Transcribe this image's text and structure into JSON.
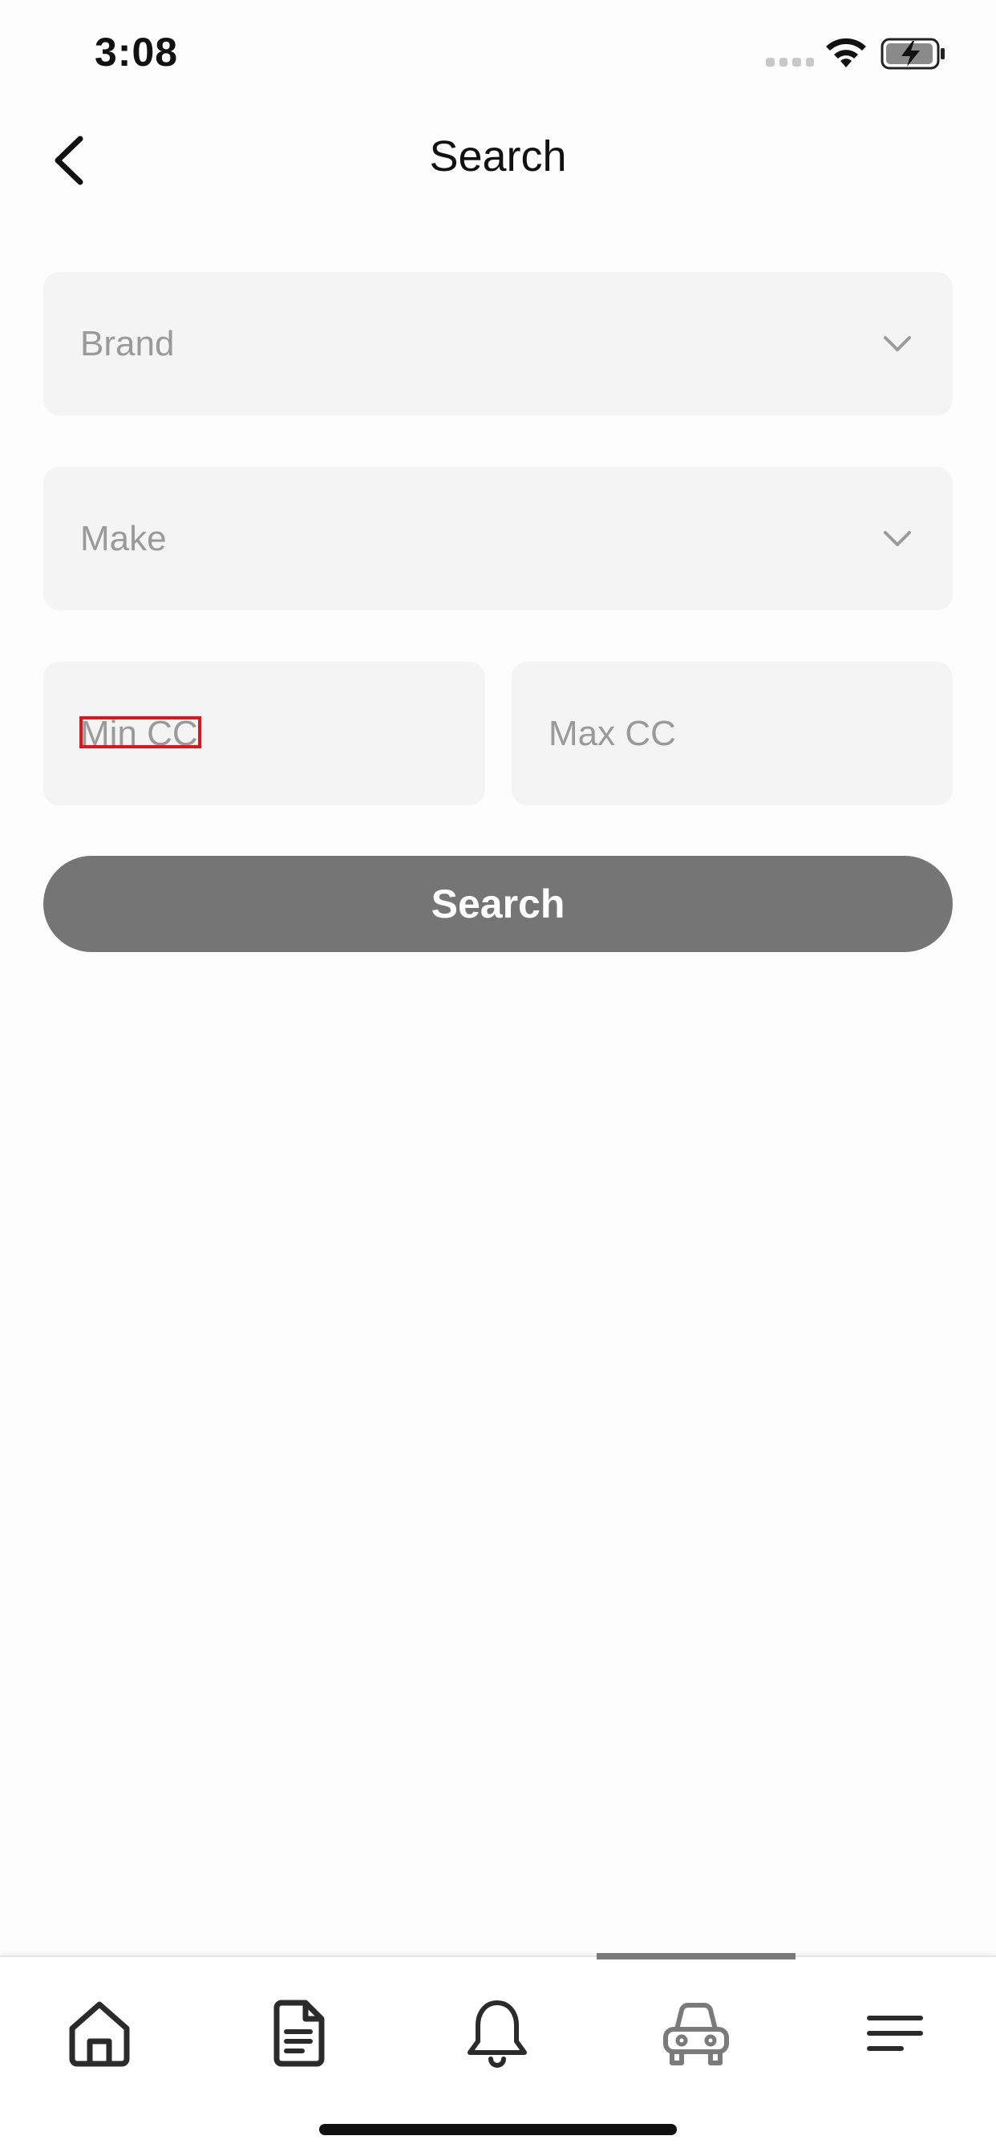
{
  "status_bar": {
    "time": "3:08",
    "icons": [
      "cellular-signal-icon",
      "wifi-icon",
      "battery-charging-icon"
    ]
  },
  "header": {
    "title": "Search",
    "back_icon": "chevron-left-icon"
  },
  "form": {
    "brand": {
      "placeholder": "Brand",
      "icon": "chevron-down-icon"
    },
    "make": {
      "placeholder": "Make",
      "icon": "chevron-down-icon"
    },
    "min_cc": {
      "placeholder": "Min CC"
    },
    "max_cc": {
      "placeholder": "Max CC"
    },
    "search_label": "Search"
  },
  "tab_bar": {
    "items": [
      {
        "icon": "home-icon"
      },
      {
        "icon": "document-icon"
      },
      {
        "icon": "bell-icon"
      },
      {
        "icon": "car-icon",
        "active": true
      },
      {
        "icon": "menu-icon"
      }
    ]
  },
  "colors": {
    "field_bg": "#f4f4f4",
    "placeholder": "#9a9a9a",
    "button_bg": "#757575",
    "focus_outline": "#e0141e"
  }
}
